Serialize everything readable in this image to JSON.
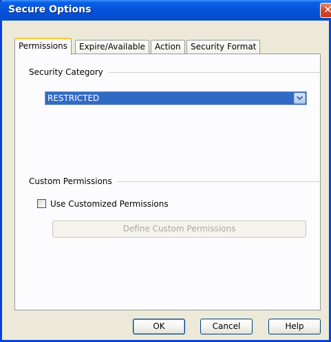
{
  "window": {
    "title": "Secure Options",
    "close_symbol": "✕"
  },
  "tabs": [
    {
      "label": "Permissions",
      "active": true
    },
    {
      "label": "Expire/Available",
      "active": false
    },
    {
      "label": "Action",
      "active": false
    },
    {
      "label": "Security Format",
      "active": false
    }
  ],
  "security_category": {
    "label": "Security Category",
    "selected": "RESTRICTED"
  },
  "custom_permissions": {
    "label": "Custom Permissions",
    "checkbox_label": "Use Customized Permissions",
    "checked": false,
    "define_button": "Define Custom Permissions"
  },
  "buttons": {
    "ok": "OK",
    "cancel": "Cancel",
    "help": "Help"
  },
  "colors": {
    "titlebar": "#0855dd",
    "selection": "#316ac5",
    "active_tab_accent": "#ffc83c"
  },
  "icons": {
    "close": "close-icon",
    "dropdown": "chevron-down-icon"
  }
}
